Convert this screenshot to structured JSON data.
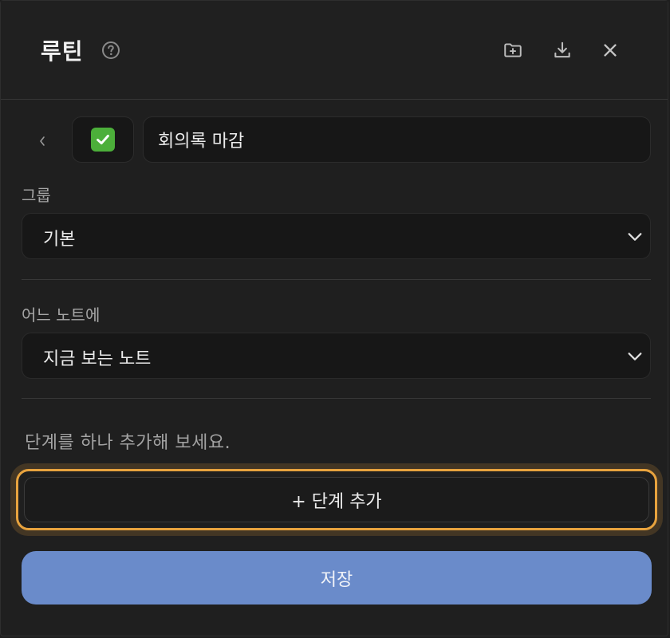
{
  "header": {
    "title": "루틴",
    "help_icon": "question-circle-icon",
    "actions": [
      "folder-add-icon",
      "download-icon",
      "close-icon"
    ]
  },
  "routine": {
    "back_icon": "chevron-left-icon",
    "emoji": "✅",
    "name": "회의록 마감"
  },
  "group": {
    "label": "그룹",
    "selected": "기본"
  },
  "note": {
    "label": "어느 노트에",
    "selected": "지금 보는 노트"
  },
  "steps": {
    "hint": "단계를 하나 추가해 보세요.",
    "add_label": "+ 단계 추가"
  },
  "save_label": "저장",
  "colors": {
    "accent": "#6a8bca",
    "focus_ring": "#e8a33e",
    "background": "#1f1f1f"
  }
}
